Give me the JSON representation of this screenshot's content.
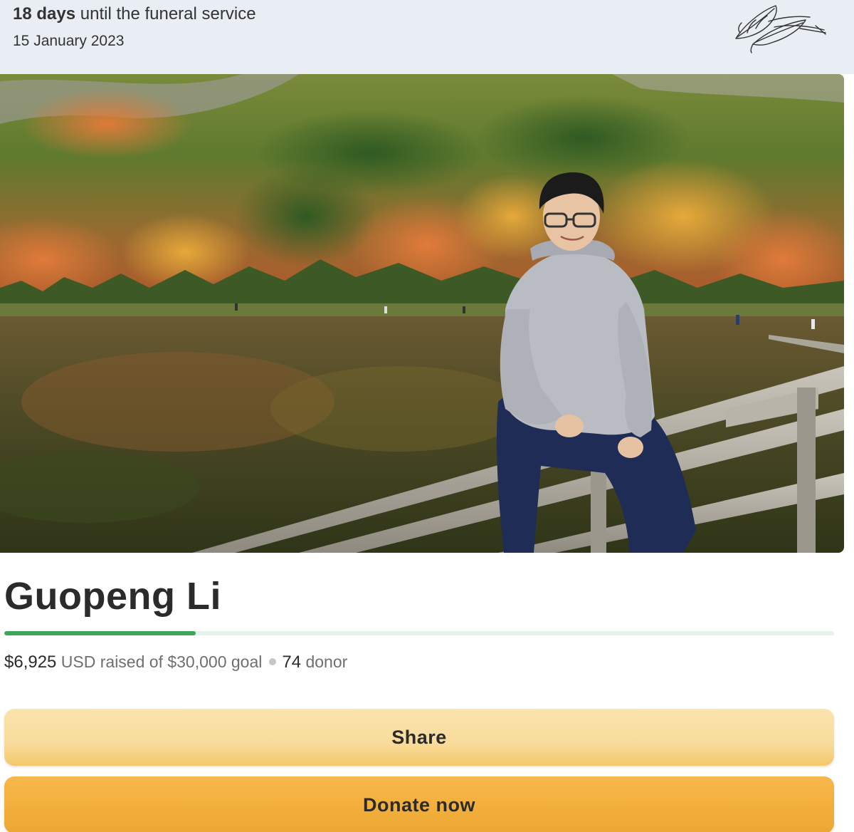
{
  "banner": {
    "days_bold": "18 days",
    "days_rest": " until the funeral service",
    "date": "15 January 2023",
    "logo_icon": "leaf-logo-icon"
  },
  "photo": {
    "description_icon": "memorial-photo"
  },
  "campaign": {
    "name": "Guopeng Li",
    "raised_amount": "$6,925",
    "raised_rest": " USD raised of $30,000 goal",
    "donor_count": "74",
    "donor_label": " donor",
    "progress_fraction": 0.2308
  },
  "buttons": {
    "share_label": "Share",
    "donate_label": "Donate now"
  },
  "colors": {
    "banner_bg": "#e9eef4",
    "progress_fill": "#3ea65a",
    "progress_track": "#e6f3ea",
    "share_bg": "#f8dc9c",
    "donate_bg": "#f2ae3a"
  }
}
